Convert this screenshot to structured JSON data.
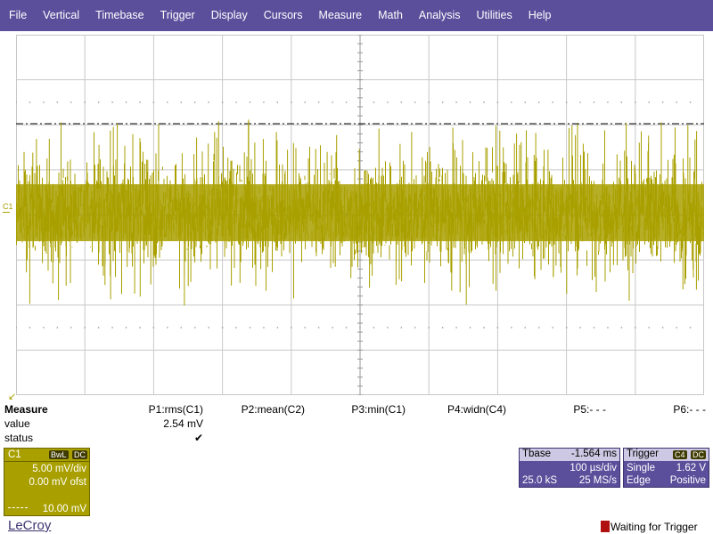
{
  "menu": [
    "File",
    "Vertical",
    "Timebase",
    "Trigger",
    "Display",
    "Cursors",
    "Measure",
    "Math",
    "Analysis",
    "Utilities",
    "Help"
  ],
  "colors": {
    "menubar": "#5b4e9b",
    "trace": "#a9a000",
    "grid": "#c8c8c8",
    "trigger_level": "#000000"
  },
  "grid": {
    "h_divisions": 10,
    "v_divisions": 8
  },
  "channel_marker": {
    "label": "C1"
  },
  "measure": {
    "title": "Measure",
    "value_label": "value",
    "status_label": "status",
    "params": [
      {
        "name": "P1:rms(C1)",
        "value": "2.54 mV",
        "status": "✔"
      },
      {
        "name": "P2:mean(C2)",
        "value": "",
        "status": ""
      },
      {
        "name": "P3:min(C1)",
        "value": "",
        "status": ""
      },
      {
        "name": "P4:widn(C4)",
        "value": "",
        "status": ""
      },
      {
        "name": "P5:- - -",
        "value": "",
        "status": ""
      },
      {
        "name": "P6:- - -",
        "value": "",
        "status": ""
      }
    ]
  },
  "channel_box": {
    "name": "C1",
    "tag1": "BwL",
    "tag2": "DC",
    "vdiv": "5.00 mV/div",
    "offset": "0.00 mV ofst",
    "scale": "10.00 mV"
  },
  "timebase": {
    "label": "Tbase",
    "delay": "-1.564 ms",
    "tdiv": "100 µs/div",
    "samples": "25.0 kS",
    "rate": "25 MS/s"
  },
  "trigger": {
    "label": "Trigger",
    "tag1": "C4",
    "tag2": "DC",
    "mode": "Single",
    "level": "1.62 V",
    "type": "Edge",
    "slope": "Positive"
  },
  "brand": "LeCroy",
  "status_text": "Waiting for Trigger"
}
